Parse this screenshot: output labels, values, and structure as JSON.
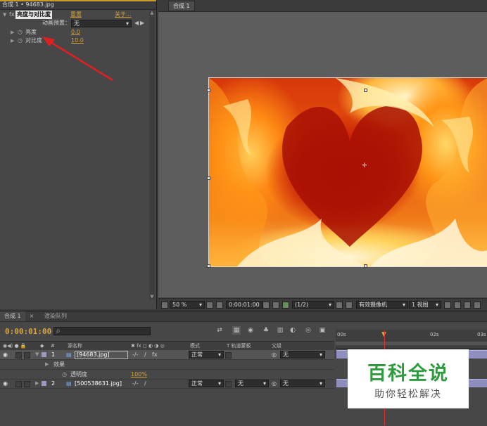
{
  "effects_panel": {
    "tab_label": "合成 1 • 94683.jpg",
    "effect_name": "亮度与对比度",
    "reset_label": "重置",
    "about_label": "关于...",
    "preset_label": "动画预置：",
    "preset_value": "无",
    "properties": [
      {
        "label": "亮度",
        "value": "0.0"
      },
      {
        "label": "对比度",
        "value": "10.0"
      }
    ]
  },
  "comp_viewer": {
    "tab_label": "合成 1",
    "toolbar": {
      "zoom": "50 %",
      "timecode": "0:00:01:00",
      "resolution": "(1/2)",
      "camera": "有效摄像机",
      "views": "1 视图"
    }
  },
  "timeline": {
    "tabs": [
      "合成 1",
      "渲染队列"
    ],
    "current_time": "0:00:01:00",
    "search_placeholder": "ρ",
    "columns": {
      "number": "#",
      "source_name": "源名称",
      "mode": "模式",
      "track_matte": "T   轨道蒙板",
      "parent": "父级"
    },
    "ruler_ticks": [
      "00s",
      "02s",
      "03s"
    ],
    "layers": [
      {
        "index": "1",
        "name": "[94683.jpg]",
        "mode": "正常",
        "matte": "",
        "parent": "无",
        "selected": true
      },
      {
        "index": "2",
        "name": "[500538631.jpg]",
        "mode": "正常",
        "matte": "无",
        "parent": "无",
        "selected": false
      }
    ],
    "effects_group_label": "效果",
    "opacity_label": "透明度",
    "opacity_value": "100%"
  },
  "watermark": {
    "title": "百科全说",
    "subtitle": "助你轻松解决"
  },
  "colors": {
    "accent_orange": "#d4a13a",
    "annotation_arrow": "#e02020",
    "layer_bar": "#8e8fbf",
    "watermark_green": "#2f9a3e"
  }
}
